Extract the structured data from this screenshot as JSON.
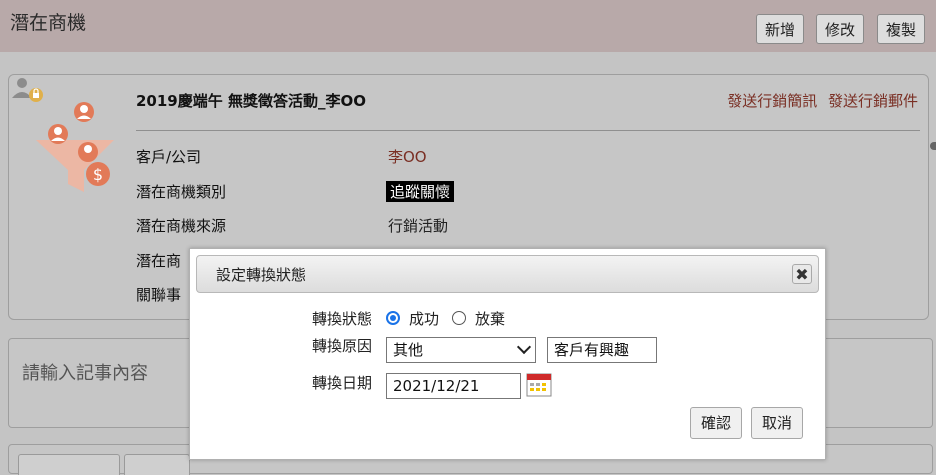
{
  "header": {
    "title": "潛在商機",
    "buttons": {
      "add": "新增",
      "edit": "修改",
      "copy": "複製"
    }
  },
  "opportunity": {
    "name": "2019慶端午 無獎徵答活動_李OO",
    "links": {
      "send_sms": "發送行銷簡訊",
      "send_email": "發送行銷郵件"
    },
    "fields": [
      {
        "label": "客戶/公司",
        "value": "李OO"
      },
      {
        "label": "潛在商機類別",
        "value": "追蹤關懷"
      },
      {
        "label": "潛在商機來源",
        "value": "行銷活動"
      },
      {
        "label": "潛在商",
        "value": ""
      },
      {
        "label": "關聯事",
        "value": ""
      }
    ]
  },
  "notes": {
    "placeholder": "請輸入記事內容"
  },
  "modal": {
    "title": "設定轉換狀態",
    "close_glyph": "✖",
    "status_label": "轉換狀態",
    "status_options": [
      {
        "label": "成功",
        "checked": true
      },
      {
        "label": "放棄",
        "checked": false
      }
    ],
    "reason_label": "轉換原因",
    "reason_selected": "其他",
    "reason_text": "客戶有興趣",
    "date_label": "轉換日期",
    "date_value": "2021/12/21",
    "confirm": "確認",
    "cancel": "取消"
  },
  "colors": {
    "topbar": "#b8a9a9",
    "overlay": "#c4c4c4",
    "link": "#7a2f24",
    "radio_accent": "#1a73e8",
    "icon_orange": "#e27a58"
  },
  "icons": [
    "user-lock-icon",
    "funnel-people-icon",
    "close-icon",
    "chevron-down-icon",
    "calendar-icon"
  ]
}
